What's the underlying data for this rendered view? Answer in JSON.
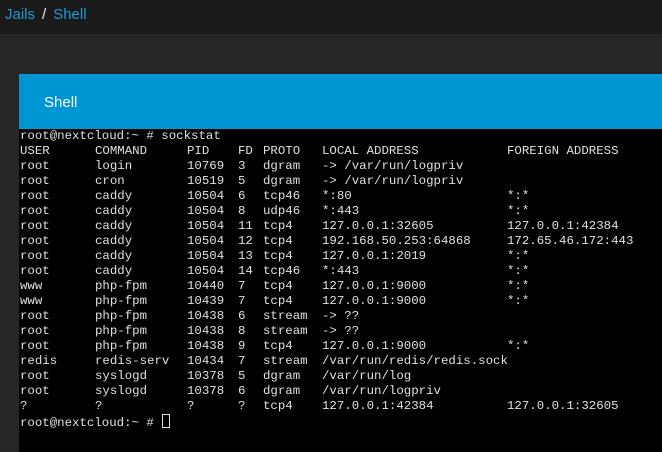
{
  "breadcrumb": {
    "items": [
      "Jails",
      "Shell"
    ],
    "separator": "/"
  },
  "card": {
    "title": "Shell"
  },
  "terminal": {
    "command_prompt": "root@nextcloud:~ # sockstat",
    "final_prompt": "root@nextcloud:~ # ",
    "headers": [
      "USER",
      "COMMAND",
      "PID",
      "FD",
      "PROTO",
      "LOCAL ADDRESS",
      "FOREIGN ADDRESS"
    ],
    "rows": [
      [
        "root",
        "login",
        "10769",
        "3",
        "dgram",
        "-> /var/run/logpriv",
        ""
      ],
      [
        "root",
        "cron",
        "10519",
        "5",
        "dgram",
        "-> /var/run/logpriv",
        ""
      ],
      [
        "root",
        "caddy",
        "10504",
        "6",
        "tcp46",
        "*:80",
        "*:*"
      ],
      [
        "root",
        "caddy",
        "10504",
        "8",
        "udp46",
        "*:443",
        "*:*"
      ],
      [
        "root",
        "caddy",
        "10504",
        "11",
        "tcp4",
        "127.0.0.1:32605",
        "127.0.0.1:42384"
      ],
      [
        "root",
        "caddy",
        "10504",
        "12",
        "tcp4",
        "192.168.50.253:64868",
        "172.65.46.172:443"
      ],
      [
        "root",
        "caddy",
        "10504",
        "13",
        "tcp4",
        "127.0.0.1:2019",
        "*:*"
      ],
      [
        "root",
        "caddy",
        "10504",
        "14",
        "tcp46",
        "*:443",
        "*:*"
      ],
      [
        "www",
        "php-fpm",
        "10440",
        "7",
        "tcp4",
        "127.0.0.1:9000",
        "*:*"
      ],
      [
        "www",
        "php-fpm",
        "10439",
        "7",
        "tcp4",
        "127.0.0.1:9000",
        "*:*"
      ],
      [
        "root",
        "php-fpm",
        "10438",
        "6",
        "stream",
        "-> ??",
        ""
      ],
      [
        "root",
        "php-fpm",
        "10438",
        "8",
        "stream",
        "-> ??",
        ""
      ],
      [
        "root",
        "php-fpm",
        "10438",
        "9",
        "tcp4",
        "127.0.0.1:9000",
        "*:*"
      ],
      [
        "redis",
        "redis-serv",
        "10434",
        "7",
        "stream",
        "/var/run/redis/redis.sock",
        ""
      ],
      [
        "root",
        "syslogd",
        "10378",
        "5",
        "dgram",
        "/var/run/log",
        ""
      ],
      [
        "root",
        "syslogd",
        "10378",
        "6",
        "dgram",
        "/var/run/logpriv",
        ""
      ],
      [
        "?",
        "?",
        "?",
        "?",
        "tcp4",
        "127.0.0.1:42384",
        "127.0.0.1:32605"
      ]
    ]
  }
}
